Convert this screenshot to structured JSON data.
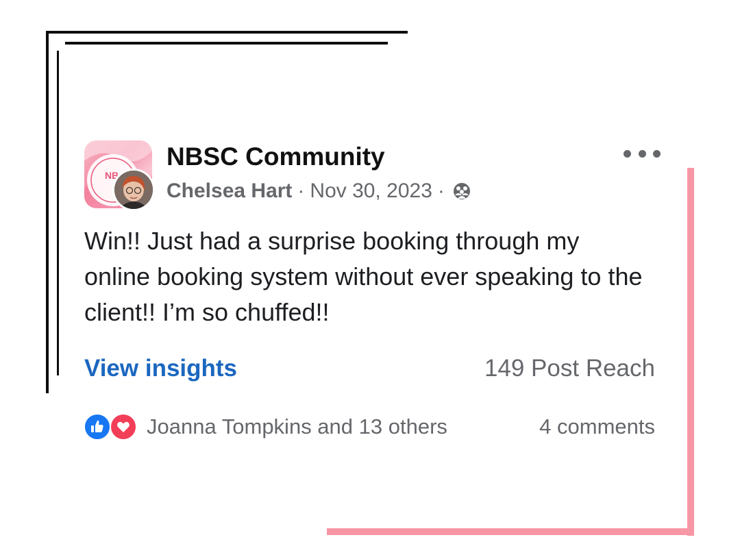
{
  "post": {
    "group_name": "NBSC Community",
    "author": "Chelsea Hart",
    "separator": "·",
    "date": "Nov 30, 2023",
    "privacy_icon": "members-icon",
    "text": "Win!! Just had a surprise booking through my online booking system without ever speaking to the client!! I’m so chuffed!!",
    "avatar_logo_text": "NB"
  },
  "insights": {
    "link_label": "View insights",
    "reach": "149 Post Reach"
  },
  "reactions": {
    "icons": [
      "like-icon",
      "love-icon"
    ],
    "summary": "Joanna Tompkins and 13 others",
    "comments": "4 comments"
  },
  "colors": {
    "link_blue": "#1b67bf",
    "muted_gray": "#65676b",
    "accent_pink": "#f797a6",
    "like_blue": "#1877f2",
    "love_red": "#f33e58"
  }
}
